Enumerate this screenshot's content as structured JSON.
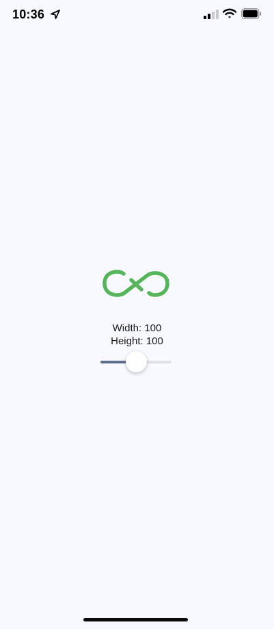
{
  "status_bar": {
    "time": "10:36",
    "location_icon": "location-arrow-icon",
    "signal_icon": "cellular-signal-icon",
    "wifi_icon": "wifi-icon",
    "battery_icon": "battery-icon"
  },
  "logo": {
    "icon": "infinity-logo-icon",
    "color": "#55b55a"
  },
  "dimensions": {
    "width_text": "Width: 100",
    "height_text": "Height: 100"
  },
  "slider": {
    "value_fraction": 0.5,
    "fill_color": "#5e6d8d",
    "track_color": "#e1e2e6"
  }
}
